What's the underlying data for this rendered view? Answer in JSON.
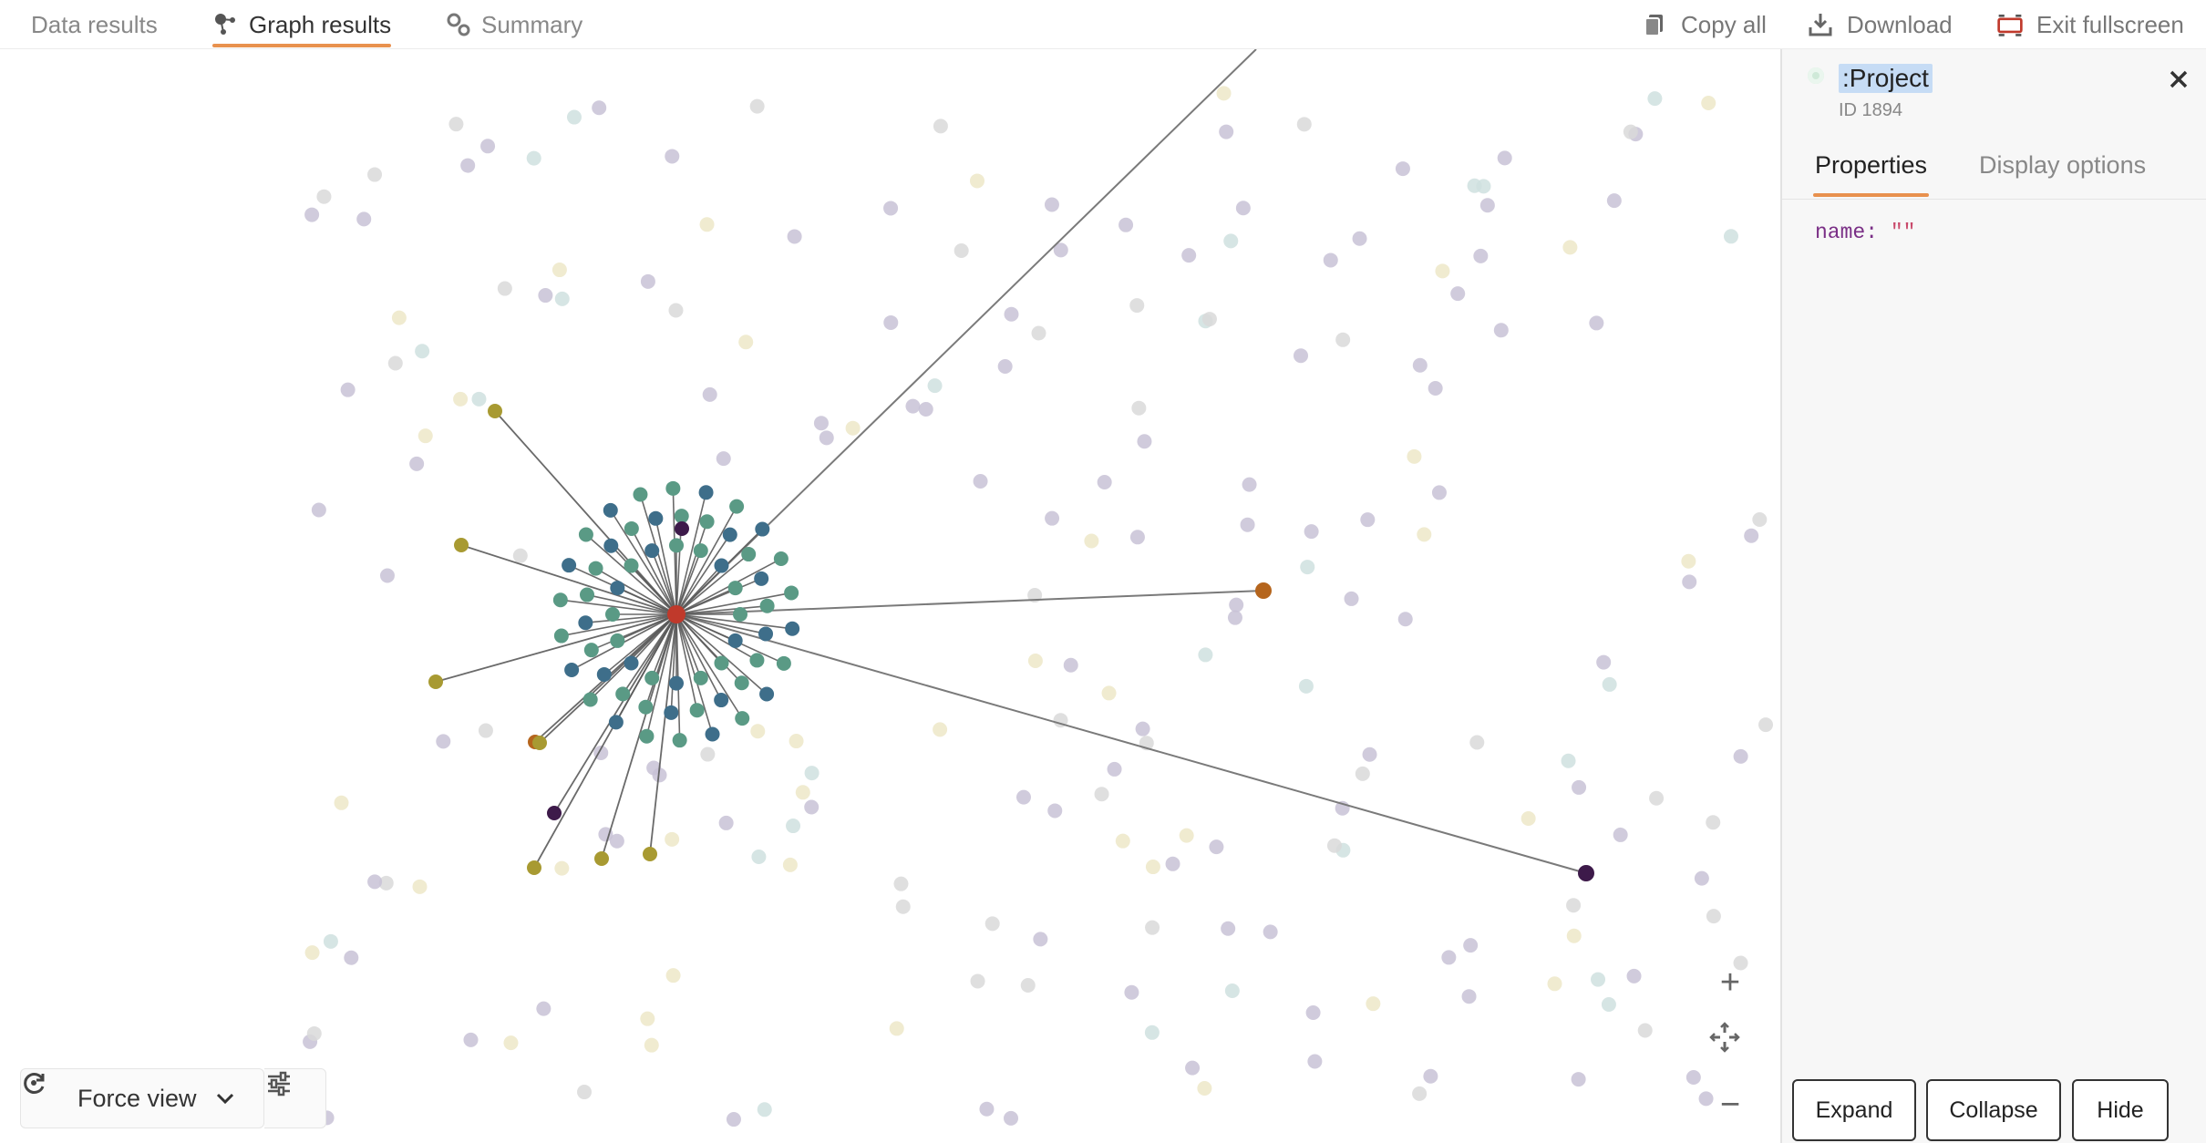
{
  "tabs": [
    {
      "label": "Data results",
      "active": false
    },
    {
      "label": "Graph results",
      "active": true
    },
    {
      "label": "Summary",
      "active": false
    }
  ],
  "actions": {
    "copy_all": "Copy all",
    "download": "Download",
    "exit_fullscreen": "Exit fullscreen"
  },
  "canvas": {
    "force_view_label": "Force view",
    "zoom_in_symbol": "+",
    "zoom_out_symbol": "−"
  },
  "panel": {
    "node_label": ":Project",
    "node_id": "ID 1894",
    "tabs": [
      {
        "label": "Properties",
        "active": true
      },
      {
        "label": "Display options",
        "active": false
      }
    ],
    "property": {
      "key": "name:",
      "value": "\"\""
    },
    "buttons": {
      "expand": "Expand",
      "collapse": "Collapse",
      "hide": "Hide"
    }
  },
  "colors": {
    "accent": "#e8914e",
    "hub": "#c0392b",
    "teal": "#5a9a85",
    "steel": "#3e6e8a",
    "olive": "#a89a32",
    "rust": "#b5651d",
    "plum": "#3d1a4a",
    "faint": "#c8c2d6"
  }
}
